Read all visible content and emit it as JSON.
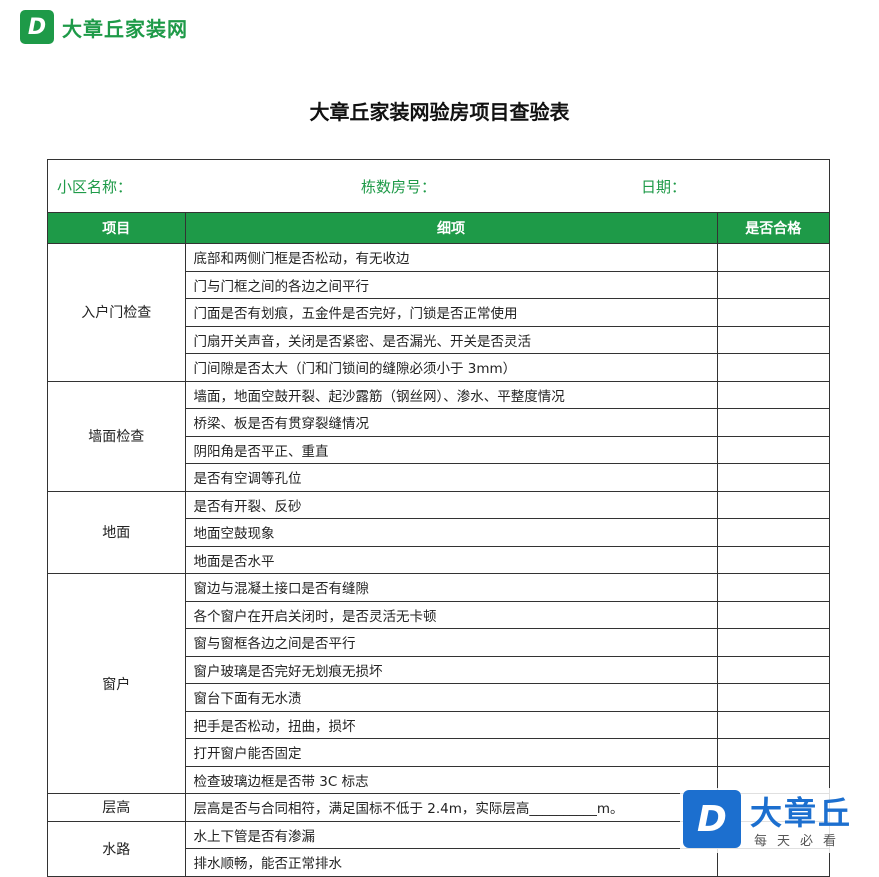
{
  "brand": {
    "logo_letter": "D",
    "name": "大章丘家装网"
  },
  "title": "大章丘家装网验房项目查验表",
  "info": {
    "community": "小区名称：",
    "building": "栋数房号：",
    "date": "日期："
  },
  "table": {
    "headers": [
      "项目",
      "细项",
      "是否合格"
    ],
    "groups": [
      {
        "category": "入户门检查",
        "items": [
          "底部和两侧门框是否松动，有无收边",
          "门与门框之间的各边之间平行",
          "门面是否有划痕，五金件是否完好，门锁是否正常使用",
          "门扇开关声音，关闭是否紧密、是否漏光、开关是否灵活",
          "门间隙是否太大（门和门锁间的缝隙必须小于 3mm）"
        ]
      },
      {
        "category": "墙面检查",
        "items": [
          "墙面，地面空鼓开裂、起沙露筋（钢丝网）、渗水、平整度情况",
          "桥梁、板是否有贯穿裂缝情况",
          "阴阳角是否平正、重直",
          "是否有空调等孔位"
        ]
      },
      {
        "category": "地面",
        "items": [
          "是否有开裂、反砂",
          "地面空鼓现象",
          "地面是否水平"
        ]
      },
      {
        "category": "窗户",
        "items": [
          "窗边与混凝土接口是否有缝隙",
          "各个窗户在开启关闭时，是否灵活无卡顿",
          "窗与窗框各边之间是否平行",
          "窗户玻璃是否完好无划痕无损坏",
          "窗台下面有无水渍",
          "把手是否松动，扭曲，损坏",
          "打开窗户能否固定",
          "检查玻璃边框是否带 3C 标志"
        ]
      },
      {
        "category": "层高",
        "items": [
          "层高是否与合同相符，满足国标不低于 2.4m，实际层高__________m。"
        ]
      },
      {
        "category": "水路",
        "items": [
          "水上下管是否有渗漏",
          "排水顺畅，能否正常排水"
        ]
      }
    ]
  },
  "watermark": {
    "letter": "D",
    "big": "大章丘",
    "small": "每天必看"
  },
  "colors": {
    "accent": "#1e9a48",
    "watermark": "#1c6fcf"
  }
}
